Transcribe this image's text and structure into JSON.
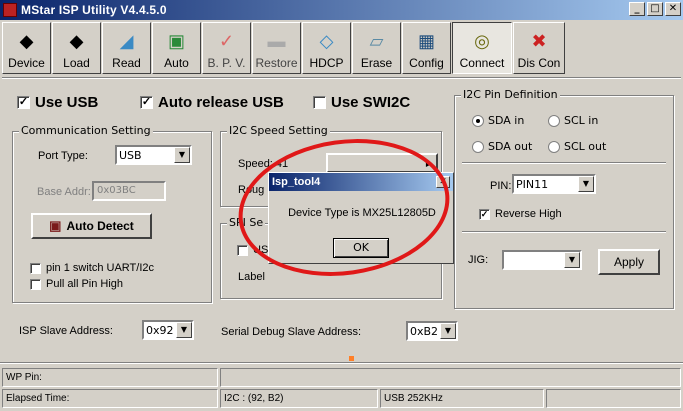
{
  "window": {
    "title": "MStar ISP Utility V4.4.5.0",
    "min": "_",
    "max": "□",
    "close": "✕"
  },
  "toolbar": [
    {
      "label": "Device",
      "icon": "device-icon",
      "glyph": "◆"
    },
    {
      "label": "Load",
      "icon": "load-icon",
      "glyph": "◆"
    },
    {
      "label": "Read",
      "icon": "read-icon",
      "glyph": "◢"
    },
    {
      "label": "Auto",
      "icon": "auto-icon",
      "glyph": "▣"
    },
    {
      "label": "B. P. V.",
      "icon": "bpv-icon",
      "glyph": "✓"
    },
    {
      "label": "Restore",
      "icon": "restore-icon",
      "glyph": "▬"
    },
    {
      "label": "HDCP",
      "icon": "hdcp-icon",
      "glyph": "◇"
    },
    {
      "label": "Erase",
      "icon": "erase-icon",
      "glyph": "▱"
    },
    {
      "label": "Config",
      "icon": "config-icon",
      "glyph": "▦"
    },
    {
      "label": "Connect",
      "icon": "connect-icon",
      "glyph": "◎"
    },
    {
      "label": "Dis Con",
      "icon": "disconnect-icon",
      "glyph": "✖"
    }
  ],
  "options": {
    "use_usb": "Use USB",
    "auto_release_usb": "Auto release USB",
    "use_swi2c": "Use SWI2C"
  },
  "comm": {
    "title": "Communication Setting",
    "port_type_label": "Port Type:",
    "port_type_value": "USB",
    "base_addr_label": "Base Addr:",
    "base_addr_value": "0x03BC",
    "auto_detect": "Auto Detect",
    "pin1_switch": "pin 1 switch UART/I2c",
    "pull_all": "Pull all Pin High"
  },
  "i2c_speed": {
    "title": "I2C Speed Setting",
    "speed_label": "Speed: 41",
    "rough_label": "Roug"
  },
  "spi": {
    "title": "SPI Se",
    "us_label": "US",
    "label_text": "Label"
  },
  "i2c_pin": {
    "title": "I2C Pin Definition",
    "sda_in": "SDA in",
    "scl_in": "SCL in",
    "sda_out": "SDA out",
    "scl_out": "SCL out",
    "pin_label": "PIN:",
    "pin_value": "PIN11",
    "reverse_high": "Reverse High",
    "jig_label": "JIG:",
    "apply": "Apply"
  },
  "addresses": {
    "isp_label": "ISP Slave Address:",
    "isp_value": "0x92",
    "serial_label": "Serial Debug Slave Address:",
    "serial_value": "0xB2"
  },
  "status": {
    "wp_pin": "WP Pin:",
    "elapsed": "Elapsed Time:",
    "i2c": "I2C : (92, B2)",
    "usb": "USB  252KHz"
  },
  "dialog": {
    "title": "Isp_tool4",
    "message": "Device Type is MX25L12805D",
    "ok": "OK",
    "close": "✕"
  },
  "colors": {
    "title_start": "#0a246a",
    "title_end": "#a6caf0",
    "annotation": "#e01818",
    "face": "#d4d0c8"
  }
}
